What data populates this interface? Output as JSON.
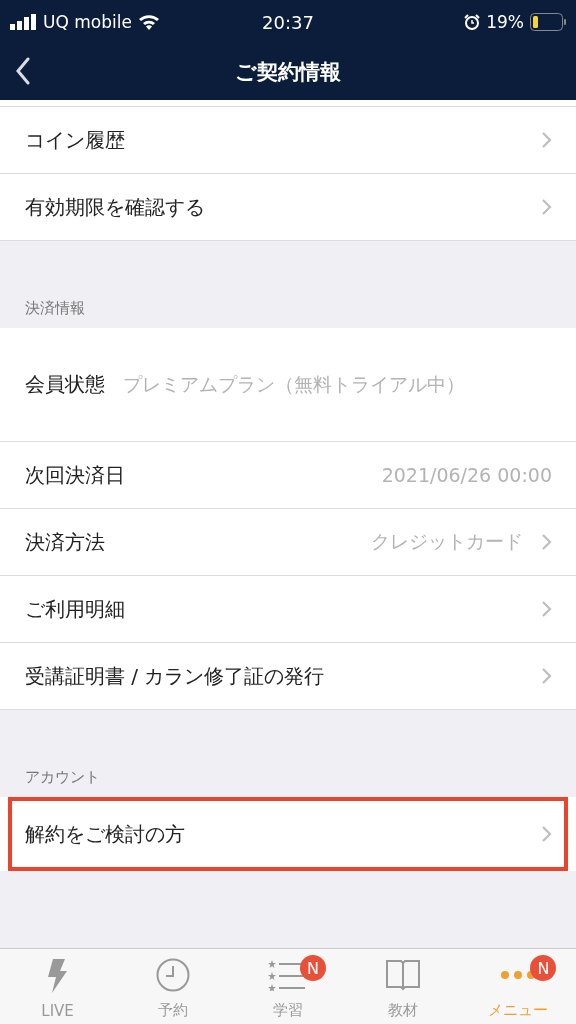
{
  "status_bar": {
    "carrier": "UQ mobile",
    "time": "20:37",
    "battery": "19%"
  },
  "nav": {
    "title": "ご契約情報"
  },
  "sections": [
    {
      "items": [
        {
          "label": "コイン履歴",
          "chevron": true,
          "highlighted": false
        },
        {
          "label": "有効期限を確認する",
          "chevron": true,
          "highlighted": false
        }
      ]
    },
    {
      "header": "決済情報",
      "items": [
        {
          "label": "会員状態",
          "value": "プレミアムプラン（無料トライアル中）",
          "kind": "tall",
          "chevron": false,
          "highlighted": false
        },
        {
          "label": "次回決済日",
          "value": "2021/06/26 00:00",
          "chevron": false,
          "highlighted": false
        },
        {
          "label": "決済方法",
          "value": "クレジットカード",
          "chevron": true,
          "highlighted": false
        },
        {
          "label": "ご利用明細",
          "chevron": true,
          "highlighted": false
        },
        {
          "label": "受講証明書 / カラン修了証の発行",
          "chevron": true,
          "highlighted": false
        }
      ]
    },
    {
      "header": "アカウント",
      "items": [
        {
          "label": "解約をご検討の方",
          "chevron": true,
          "highlighted": true
        }
      ]
    }
  ],
  "tabs": [
    {
      "label": "LIVE",
      "selected": false
    },
    {
      "label": "予約",
      "selected": false
    },
    {
      "label": "学習",
      "selected": false,
      "badge": "N"
    },
    {
      "label": "教材",
      "selected": false
    },
    {
      "label": "メニュー",
      "selected": true,
      "badge": "N"
    }
  ]
}
